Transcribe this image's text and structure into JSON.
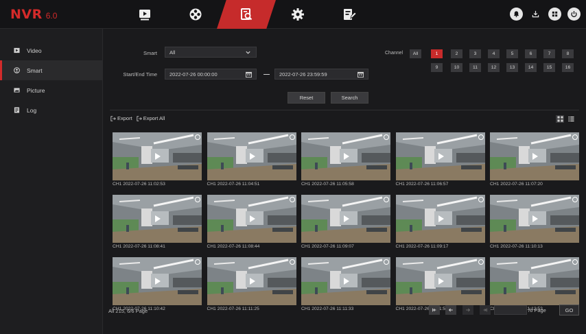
{
  "app": {
    "logo_main": "NVR",
    "logo_version": "6.0"
  },
  "topnav": {
    "tabs": [
      {
        "name": "playback-tab",
        "icon": "play-icon"
      },
      {
        "name": "channel-tab",
        "icon": "camera-grid-icon"
      },
      {
        "name": "search-tab",
        "icon": "file-search-icon",
        "active": true
      },
      {
        "name": "settings-tab",
        "icon": "gear-icon"
      },
      {
        "name": "maintenance-tab",
        "icon": "edit-doc-icon"
      }
    ],
    "right_icons": [
      "alarm-icon",
      "download-icon",
      "grid-icon",
      "power-icon"
    ]
  },
  "sidebar": {
    "items": [
      {
        "label": "Video",
        "icon": "video-icon"
      },
      {
        "label": "Smart",
        "icon": "smart-icon",
        "active": true
      },
      {
        "label": "Picture",
        "icon": "picture-icon"
      },
      {
        "label": "Log",
        "icon": "log-icon"
      }
    ]
  },
  "filters": {
    "smart_label": "Smart",
    "smart_value": "All",
    "time_label": "Start/End Time",
    "start_time": "2022-07-26 00:00:00",
    "end_time": "2022-07-26 23:59:59",
    "reset_label": "Reset",
    "search_label": "Search"
  },
  "channels": {
    "label": "Channel",
    "all_label": "All",
    "row1": [
      "1",
      "2",
      "3",
      "4",
      "5",
      "6",
      "7",
      "8"
    ],
    "row2": [
      "9",
      "10",
      "11",
      "12",
      "13",
      "14",
      "15",
      "16"
    ],
    "selected": "1"
  },
  "toolbar": {
    "export_label": "Export",
    "export_all_label": "Export All"
  },
  "results": {
    "items": [
      "CH1 2022-07-26 11:02:53",
      "CH1 2022-07-26 11:04:51",
      "CH1 2022-07-26 11:05:58",
      "CH1 2022-07-26 11:06:57",
      "CH1 2022-07-26 11:07:20",
      "CH1 2022-07-26 11:08:41",
      "CH1 2022-07-26 11:08:44",
      "CH1 2022-07-26 11:09:07",
      "CH1 2022-07-26 11:09:17",
      "CH1 2022-07-26 11:10:13",
      "CH1 2022-07-26 11:10:42",
      "CH1 2022-07-26 11:11:25",
      "CH1 2022-07-26 11:11:33",
      "CH1 2022-07-26 11:11:54",
      "CH1 2022-07-26 11:12:53"
    ]
  },
  "pagination": {
    "summary": "All 215, 6/6 Page",
    "page_value": "",
    "suffix": "/6 Page",
    "go_label": "GO"
  },
  "colors": {
    "accent": "#c92b2b",
    "background": "#1a1a1c"
  }
}
